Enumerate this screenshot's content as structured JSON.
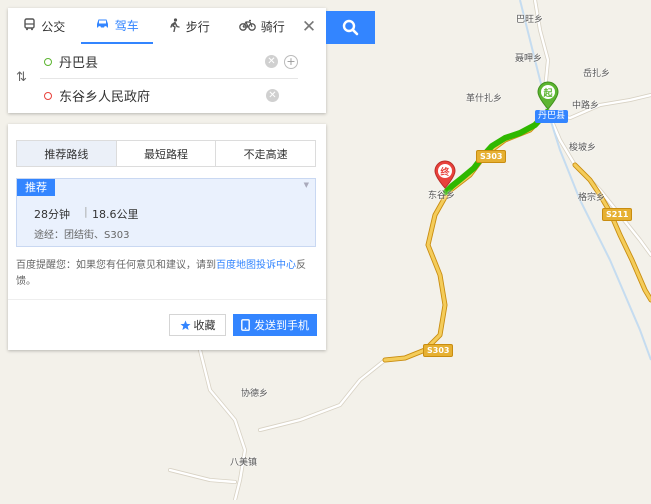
{
  "travel_modes": [
    {
      "label": "公交",
      "icon": "bus-icon"
    },
    {
      "label": "驾车",
      "icon": "car-icon"
    },
    {
      "label": "步行",
      "icon": "walk-icon"
    },
    {
      "label": "骑行",
      "icon": "bicycle-icon"
    }
  ],
  "active_mode": "驾车",
  "route": {
    "start": "丹巴县",
    "end": "东谷乡人民政府"
  },
  "strategy_tabs": [
    "推荐路线",
    "最短路程",
    "不走高速"
  ],
  "result": {
    "badge": "推荐",
    "time": "28分钟",
    "distance": "18.6公里",
    "via": "途经：团结街、S303"
  },
  "tip": {
    "prefix": "百度提醒您：如果您有任何意见和建议，请到",
    "link": "百度地图投诉中心",
    "suffix": "反馈。"
  },
  "buttons": {
    "favorite": "收藏",
    "send": "发送到手机"
  },
  "map": {
    "start_marker": "起",
    "end_marker": "终",
    "city_label": "丹巴县",
    "place_labels": [
      "巴旺乡",
      "聂呷乡",
      "岳扎乡",
      "革什扎乡",
      "中路乡",
      "梭坡乡",
      "格宗乡",
      "东谷乡",
      "协德乡",
      "八美镇"
    ],
    "road_labels": [
      "S303",
      "S211",
      "S303"
    ]
  },
  "colors": {
    "accent": "#3385ff",
    "route_line": "#2fb800",
    "start_marker": "#5cb531",
    "end_marker": "#e8423c",
    "road": "#e6b032"
  }
}
